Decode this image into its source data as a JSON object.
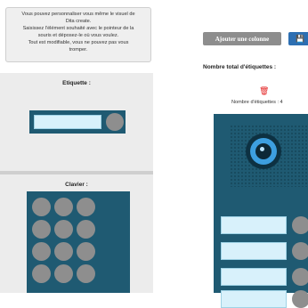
{
  "help": {
    "lines": [
      "Vous pouvez personnaliser vous même le visuel de",
      "Dita create.",
      "Saisissez l'élément souhaité avec le pointeur de la",
      "souris et déposez-le où vous voulez.",
      "Tout est modifiable, vous ne pouvez pas vous",
      "tromper."
    ]
  },
  "palette": {
    "etiquette_title": "Etiquette :",
    "clavier_title": "Clavier :"
  },
  "toolbar": {
    "add_column_label": "Ajouter une colonne",
    "save_icon_glyph": "💾"
  },
  "preview": {
    "total_label": "Nombre total d'étiquettes :",
    "delete_icon_glyph": "🗑",
    "count_text": "Nombre d'étiquettes : 4"
  },
  "colors": {
    "device": "#1f5a72",
    "label_field": "#d8f1fb",
    "key": "#8e8e8e",
    "accent_blue": "#2d6fb2",
    "delete_red": "#e32222"
  },
  "icons": [
    "save-icon",
    "trash-icon",
    "camera-icon",
    "speaker-grille"
  ]
}
